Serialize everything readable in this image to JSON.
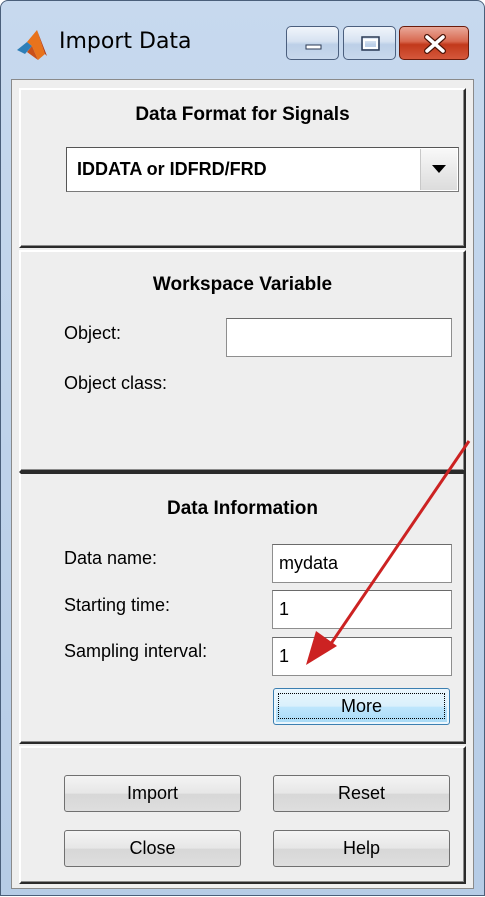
{
  "window": {
    "title": "Import Data",
    "controls": [
      "minimize-icon",
      "maximize-icon",
      "close-icon"
    ]
  },
  "data_format": {
    "heading": "Data Format for Signals",
    "selected": "IDDATA or IDFRD/FRD"
  },
  "workspace": {
    "heading": "Workspace Variable",
    "object_label": "Object:",
    "object_value": "",
    "object_class_label": "Object class:"
  },
  "data_info": {
    "heading": "Data Information",
    "data_name_label": "Data name:",
    "data_name_value": "mydata",
    "starting_time_label": "Starting time:",
    "starting_time_value": "1",
    "sampling_interval_label": "Sampling interval:",
    "sampling_interval_value": "1",
    "more_label": "More"
  },
  "actions": {
    "import_label": "Import",
    "reset_label": "Reset",
    "close_label": "Close",
    "help_label": "Help"
  },
  "colors": {
    "annotation_arrow": "#cc2222",
    "focus_button": "#bee6fd"
  }
}
